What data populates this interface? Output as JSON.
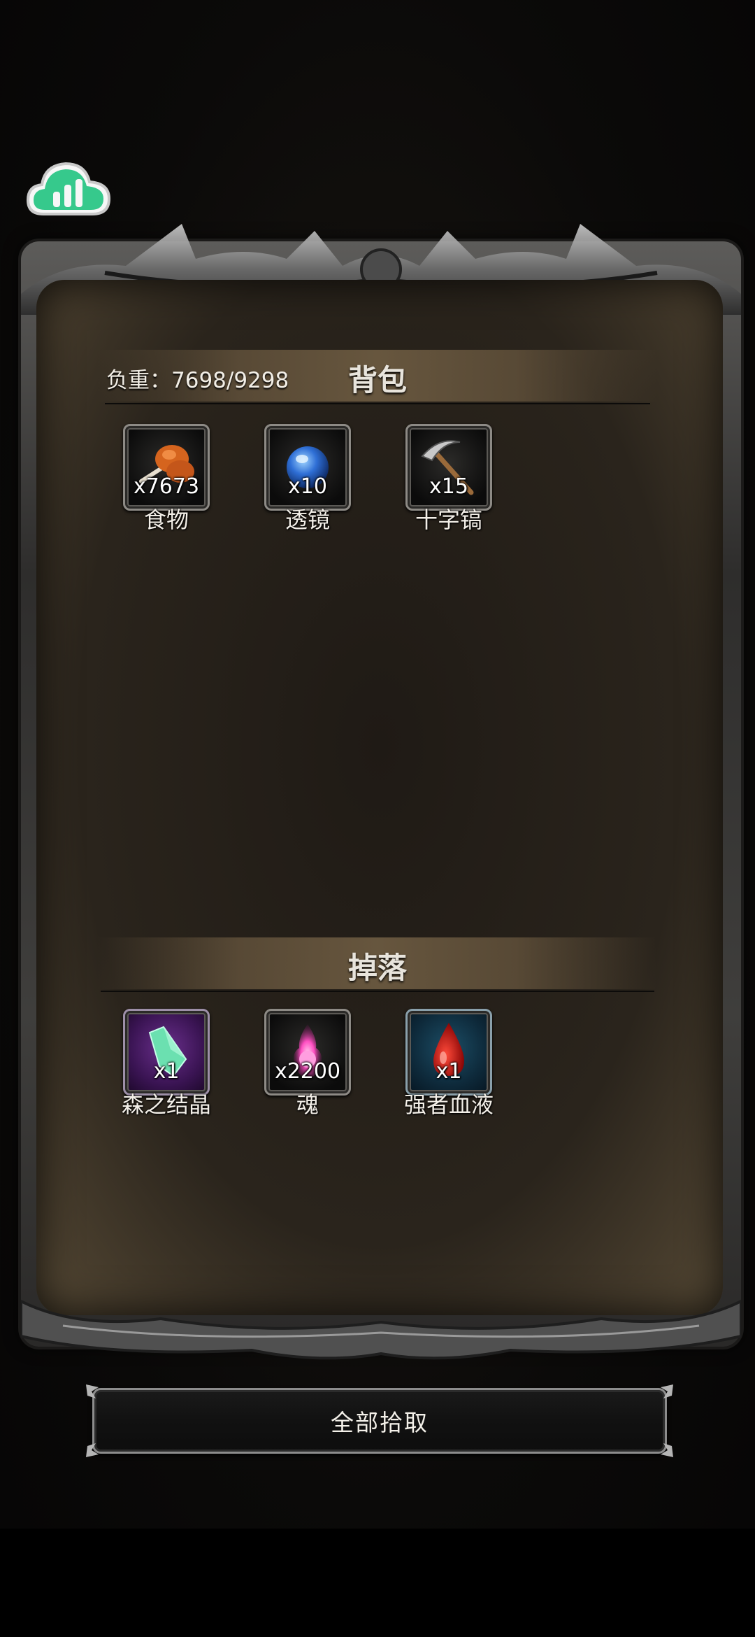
{
  "backpack": {
    "title": "背包",
    "weight_label": "负重：7698/9298",
    "items": [
      {
        "name": "食物",
        "qty": "x7673",
        "icon": "roast-meat-icon"
      },
      {
        "name": "透镜",
        "qty": "x10",
        "icon": "blue-orb-icon"
      },
      {
        "name": "十字镐",
        "qty": "x15",
        "icon": "pickaxe-icon"
      }
    ]
  },
  "drops": {
    "title": "掉落",
    "items": [
      {
        "name": "森之结晶",
        "qty": "x1",
        "icon": "green-crystal-icon",
        "frame": "purple"
      },
      {
        "name": "魂",
        "qty": "x2200",
        "icon": "pink-soul-orb-icon",
        "frame": "normal"
      },
      {
        "name": "强者血液",
        "qty": "x1",
        "icon": "blood-drop-icon",
        "frame": "teal"
      }
    ]
  },
  "actions": {
    "pick_all_label": "全部拾取"
  },
  "colors": {
    "panel_text": "#e8e4dc",
    "cloud_green": "#33c98a"
  }
}
